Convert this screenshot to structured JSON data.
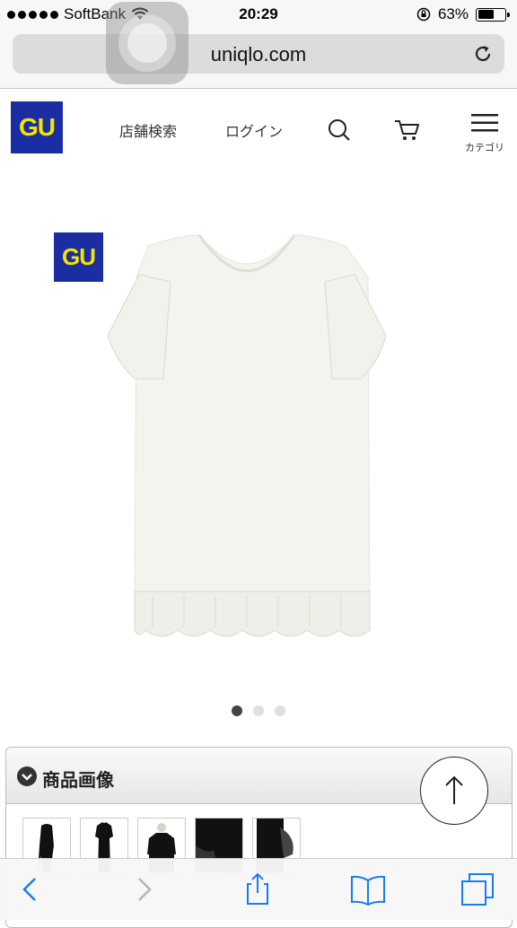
{
  "status_bar": {
    "carrier": "SoftBank",
    "time": "20:29",
    "battery_percent_label": "63%",
    "battery_level": 0.63
  },
  "browser": {
    "url": "uniqlo.com"
  },
  "site_header": {
    "logo_text": "GU",
    "store_search_label": "店舗検索",
    "login_label": "ログイン",
    "category_label": "カテゴリ",
    "brand_colors": {
      "navy": "#1b2ea1",
      "yellow": "#f5e400"
    }
  },
  "product": {
    "badge_text": "GU",
    "carousel": {
      "total": 3,
      "active_index": 0
    }
  },
  "images_panel": {
    "title": "商品画像",
    "thumbnail_count": 5
  },
  "icons": [
    "wifi-icon",
    "orientation-lock-icon",
    "battery-icon",
    "reload-icon",
    "search-icon",
    "cart-icon",
    "menu-icon",
    "back-icon",
    "forward-icon",
    "share-icon",
    "bookmarks-icon",
    "tabs-icon",
    "scroll-to-top-icon"
  ]
}
